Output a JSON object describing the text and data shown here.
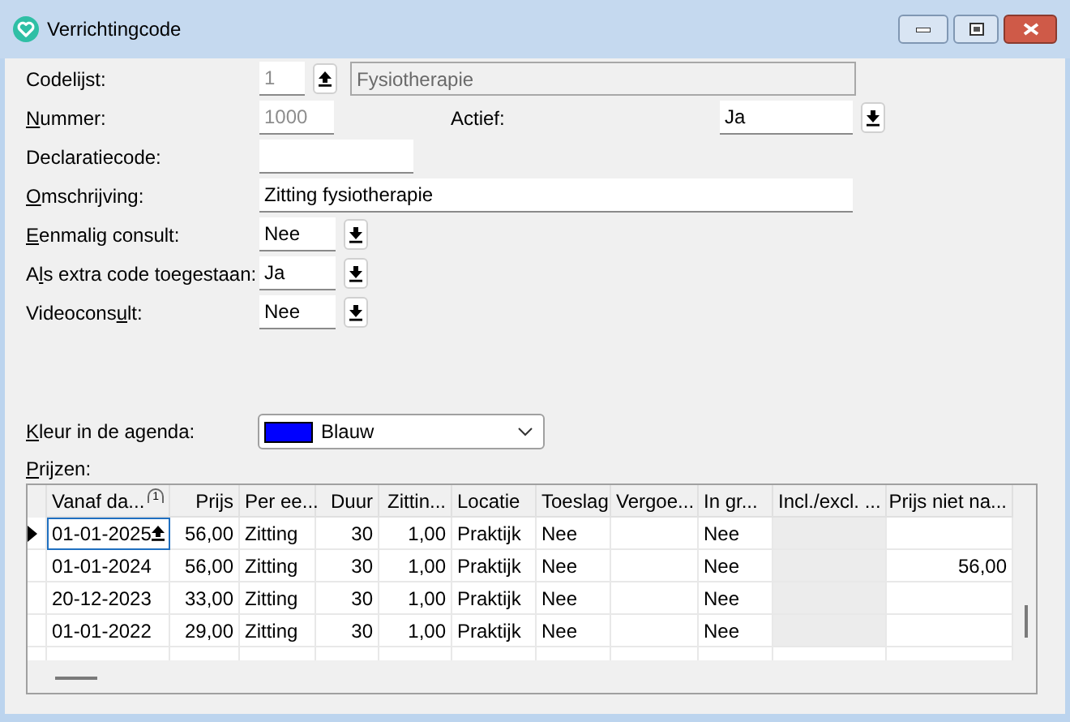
{
  "window": {
    "title": "Verrichtingcode"
  },
  "form_rows": [
    {
      "kind": "code_list",
      "label": {
        "pre": "Codelijst:"
      },
      "code": {
        "value": "1",
        "disabled": true
      },
      "name": {
        "value": "Fysiotherapie",
        "disabled": true
      }
    },
    {
      "kind": "number_active",
      "label": {
        "key": "N",
        "post": "ummer:"
      },
      "value": "1000",
      "disabled": true,
      "second_label": {
        "pre": "Actief:"
      },
      "second_value": "Ja"
    },
    {
      "kind": "short_text",
      "label": {
        "pre": "Declaratiecode:"
      }
    },
    {
      "kind": "long_text",
      "label": {
        "key": "O",
        "post": "mschrijving:"
      },
      "value": "Zitting fysiotherapie"
    },
    {
      "kind": "select",
      "label": {
        "key": "E",
        "post": "enmalig consult:"
      },
      "value": "Nee"
    },
    {
      "kind": "select",
      "label": {
        "pre": "A",
        "key": "l",
        "post": "s extra code toegestaan:"
      },
      "value": "Ja"
    },
    {
      "kind": "select",
      "label": {
        "pre": "Videocons",
        "key": "u",
        "post": "lt:"
      },
      "value": "Nee"
    }
  ],
  "color_field": {
    "label": {
      "key": "K",
      "post": "leur in de agenda:"
    },
    "value": "Blauw",
    "color": "#0000ff"
  },
  "prices": {
    "label": {
      "key": "P",
      "post": "rijzen:"
    },
    "columns": [
      {
        "title": "Vanaf da...",
        "kind": "text",
        "sorted": true,
        "disabled": false
      },
      {
        "title": "Prijs",
        "kind": "number",
        "sorted": false,
        "disabled": false
      },
      {
        "title": "Per ee...",
        "kind": "text",
        "sorted": false,
        "disabled": false
      },
      {
        "title": "Duur",
        "kind": "number",
        "sorted": false,
        "disabled": false
      },
      {
        "title": "Zittin...",
        "kind": "number",
        "sorted": false,
        "disabled": false
      },
      {
        "title": "Locatie",
        "kind": "text",
        "sorted": false,
        "disabled": false
      },
      {
        "title": "Toeslag",
        "kind": "text",
        "sorted": false,
        "disabled": false
      },
      {
        "title": "Vergoe...",
        "kind": "text",
        "sorted": false,
        "disabled": false
      },
      {
        "title": "In gr...",
        "kind": "text",
        "sorted": false,
        "disabled": false
      },
      {
        "title": "Incl./excl. ...",
        "kind": "text",
        "sorted": false,
        "disabled": true
      },
      {
        "title": "Prijs niet na...",
        "kind": "number",
        "sorted": false,
        "disabled": false
      }
    ],
    "sort_mark": "1",
    "rows": [
      {
        "current": true,
        "cells": [
          "01-01-2025",
          "56,00",
          "Zitting",
          "30",
          "1,00",
          "Praktijk",
          "Nee",
          null,
          "Nee",
          null,
          null
        ]
      },
      {
        "current": false,
        "cells": [
          "01-01-2024",
          "56,00",
          "Zitting",
          "30",
          "1,00",
          "Praktijk",
          "Nee",
          null,
          "Nee",
          null,
          "56,00"
        ]
      },
      {
        "current": false,
        "cells": [
          "20-12-2023",
          "33,00",
          "Zitting",
          "30",
          "1,00",
          "Praktijk",
          "Nee",
          null,
          "Nee",
          null,
          null
        ]
      },
      {
        "current": false,
        "cells": [
          "01-01-2022",
          "29,00",
          "Zitting",
          "30",
          "1,00",
          "Praktijk",
          "Nee",
          null,
          "Nee",
          null,
          null
        ]
      }
    ]
  }
}
